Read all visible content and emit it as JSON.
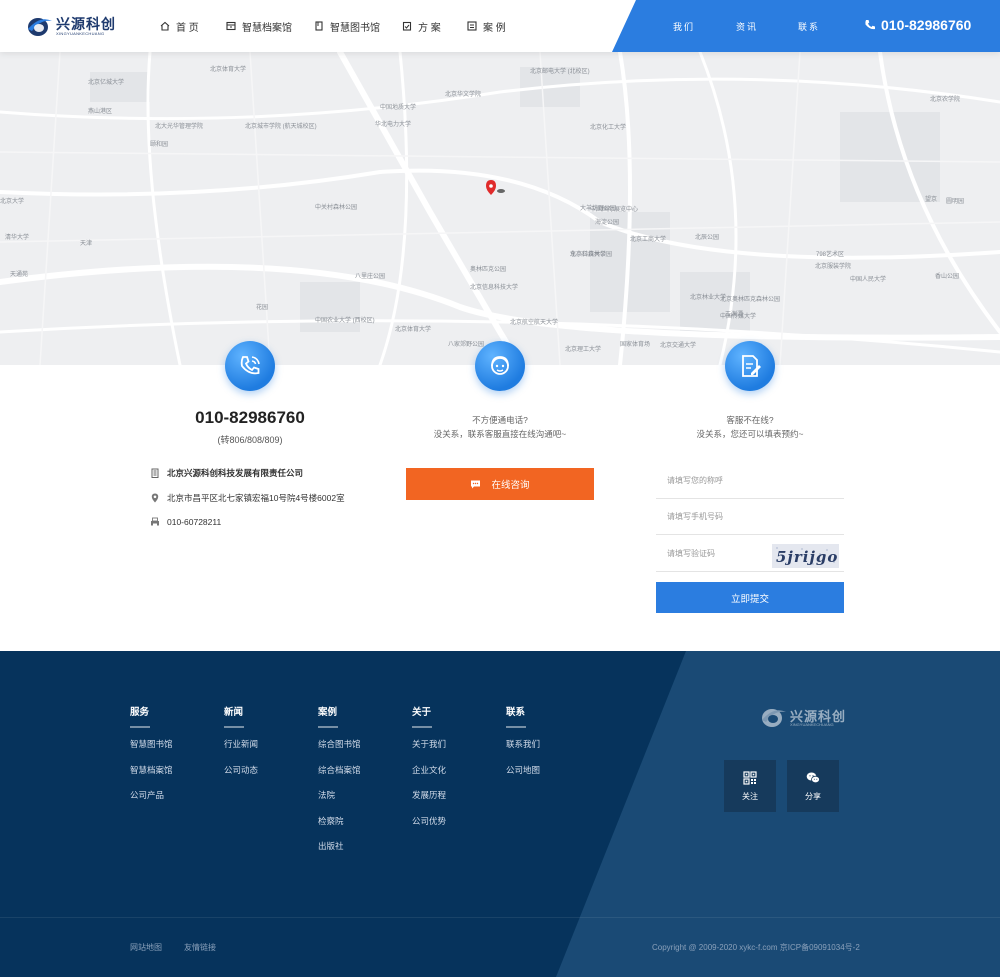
{
  "header": {
    "logo_name": "兴源科创",
    "logo_sub": "XINGYUANKECHUANG",
    "nav": [
      "首 页",
      "智慧档案馆",
      "智慧图书馆",
      "方 案",
      "案 例"
    ],
    "right_links": [
      "我们",
      "资讯",
      "联系"
    ],
    "phone": "010-82986760",
    "accent_color": "#2b7de0"
  },
  "map": {
    "labels": [
      "北京亿城大学",
      "北京邮电大学 (北校区)",
      "北京体育大学",
      "中国地质大学",
      "北京华文学院",
      "燕山港区",
      "北京化工大学",
      "北大光华管理学院",
      "北京城市学院 (航天城校区)",
      "北京农学院",
      "华北电力大学",
      "中关村森林公园",
      "大羊坊野公园",
      "北京信息科技大学",
      "北京工商大学",
      "北辰公园",
      "八里庄公园",
      "奥林匹克公园",
      "北京科技大学",
      "北京林业大学",
      "北京体育大学",
      "八家郊野公园",
      "中国农业大学 (西校区)",
      "天津",
      "花园",
      "东小口森林公园",
      "北京航空航天大学",
      "北京理工大学",
      "北京交通大学",
      "北京服装学院",
      "中国人民大学",
      "中国传媒大学",
      "国家体育场",
      "北京大学",
      "清华大学",
      "圆明园",
      "颐和园",
      "香山公园",
      "海淀公园",
      "玉渊潭",
      "中国国际展览中心",
      "望京",
      "798艺术区",
      "北京奥林匹克森林公园",
      "天通苑"
    ]
  },
  "contact": {
    "phone": "010-82986760",
    "phone_ext": "(转806/808/809)",
    "company": "北京兴源科创科技发展有限责任公司",
    "address": "北京市昌平区北七家镇宏福10号院4号楼6002室",
    "fax": "010-60728211",
    "middle_line1": "不方便通电话?",
    "middle_line2": "没关系，联系客服直接在线沟通吧~",
    "consult_button": "在线咨询",
    "right_line1": "客服不在线?",
    "right_line2": "没关系，您还可以填表预约~",
    "name_placeholder": "请填写您的称呼",
    "phone_placeholder": "请填写手机号码",
    "captcha_placeholder": "请填写验证码",
    "captcha_text": "5jrijgo",
    "submit_button": "立即提交",
    "orange_color": "#f26522"
  },
  "footer": {
    "columns": [
      {
        "title": "服务",
        "links": [
          "智慧图书馆",
          "智慧档案馆",
          "公司产品"
        ]
      },
      {
        "title": "新闻",
        "links": [
          "行业新闻",
          "公司动态"
        ]
      },
      {
        "title": "案例",
        "links": [
          "综合图书馆",
          "综合档案馆",
          "法院",
          "检察院",
          "出版社"
        ]
      },
      {
        "title": "关于",
        "links": [
          "关于我们",
          "企业文化",
          "发展历程",
          "公司优势"
        ]
      },
      {
        "title": "联系",
        "links": [
          "联系我们",
          "公司地图"
        ]
      }
    ],
    "logo_name": "兴源科创",
    "logo_sub": "XINGYUANKECHUANG",
    "follow_label": "关注",
    "share_label": "分享",
    "bottom_links": [
      "网站地图",
      "友情链接"
    ],
    "copyright": "Copyright @ 2009-2020 xykc-f.com 京ICP备09091034号-2",
    "bg_color": "#0e3a63"
  }
}
